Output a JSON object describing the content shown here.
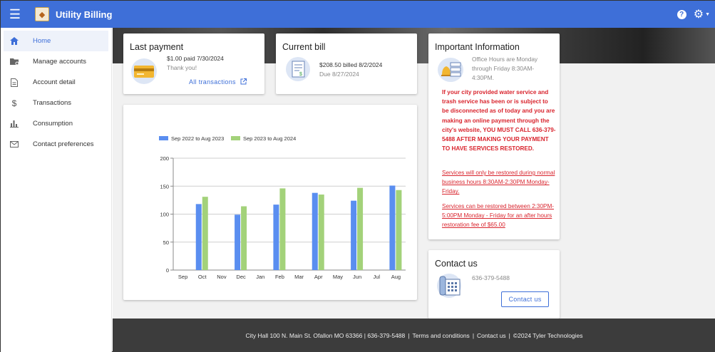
{
  "app": {
    "title": "Utility Billing"
  },
  "sidebar": {
    "items": [
      {
        "label": "Home",
        "icon": "home-icon"
      },
      {
        "label": "Manage accounts",
        "icon": "manage-accounts-icon"
      },
      {
        "label": "Account detail",
        "icon": "document-icon"
      },
      {
        "label": "Transactions",
        "icon": "dollar-icon"
      },
      {
        "label": "Consumption",
        "icon": "bar-chart-icon"
      },
      {
        "label": "Contact preferences",
        "icon": "mail-icon"
      }
    ]
  },
  "last_payment": {
    "title": "Last payment",
    "line1": "$1.00 paid 7/30/2024",
    "line2": "Thank you!",
    "link": "All transactions"
  },
  "current_bill": {
    "title": "Current bill",
    "line1": "$208.50 billed 8/2/2024",
    "line2": "Due 8/27/2024"
  },
  "important": {
    "title": "Important Information",
    "hours": "Office Hours are Monday through Friday 8:30AM-4:30PM.",
    "warning": "If your city provided water service and trash service has been or is subject to be  disconnected as of today and you are making an online payment through the city's website, YOU MUST CALL 636-379-5488 AFTER MAKING YOUR PAYMENT TO HAVE SERVICES RESTORED.",
    "note1": "Services will only be restored during normal business hours 8:30AM-2:30PM Monday-Friday.",
    "note2": "Services can be restored between 2:30PM-5:00PM Monday - Friday for an after hours restoration fee of $65.00"
  },
  "contact": {
    "title": "Contact us",
    "phone": "636-379-5488",
    "button": "Contact us"
  },
  "footer": {
    "address": "City Hall 100 N. Main St. Ofallon MO 63366 | 636-379-5488",
    "terms": "Terms and conditions",
    "contact": "Contact us",
    "copyright": "©2024 Tyler Technologies",
    "sep": "|"
  },
  "colors": {
    "accent": "#3e6fd8",
    "series1": "#5a8ef0",
    "series2": "#a3d27a",
    "warning": "#d9252e"
  },
  "chart_data": {
    "type": "bar",
    "categories": [
      "Sep",
      "Oct",
      "Nov",
      "Dec",
      "Jan",
      "Feb",
      "Mar",
      "Apr",
      "May",
      "Jun",
      "Jul",
      "Aug"
    ],
    "series": [
      {
        "name": "Sep 2022 to Aug 2023",
        "values": [
          0,
          118,
          0,
          99,
          0,
          117,
          0,
          138,
          0,
          124,
          0,
          151
        ]
      },
      {
        "name": "Sep 2023 to Aug 2024",
        "values": [
          0,
          131,
          0,
          114,
          0,
          146,
          0,
          135,
          0,
          147,
          0,
          143
        ]
      }
    ],
    "ylim": [
      0,
      200
    ],
    "yticks": [
      0,
      50,
      100,
      150,
      200
    ],
    "legend": "top-left",
    "grid": true
  }
}
